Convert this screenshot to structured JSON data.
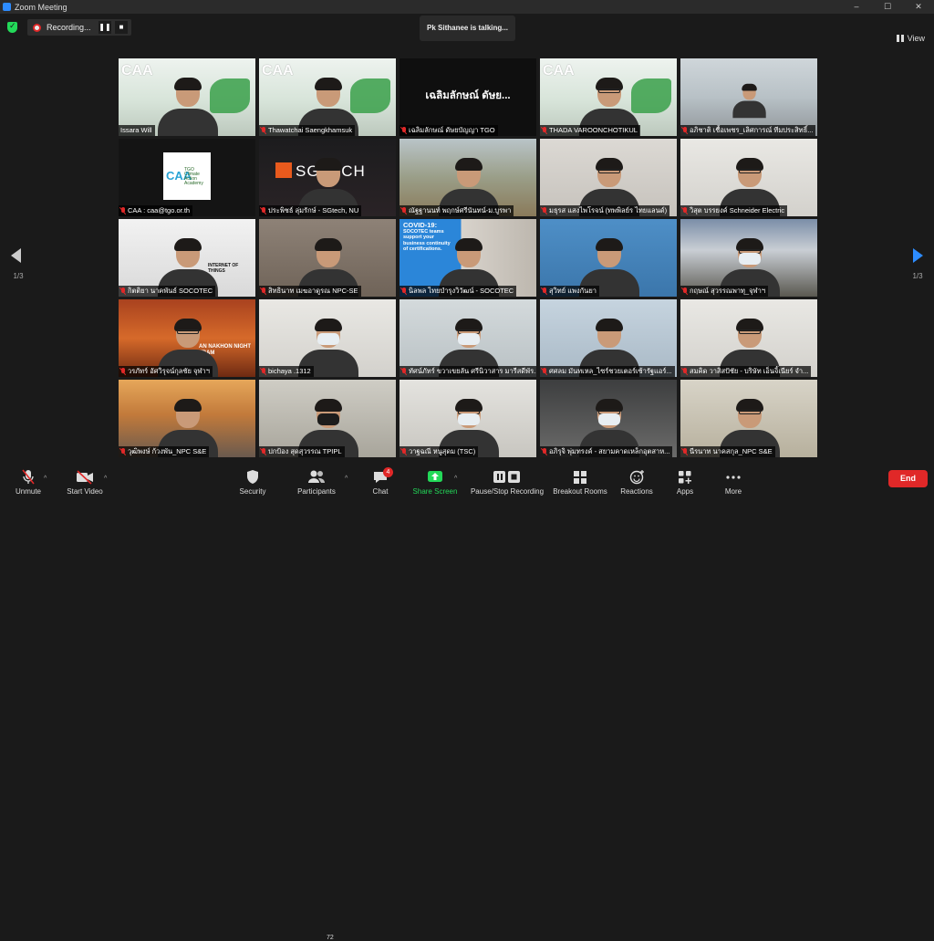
{
  "window": {
    "title": "Zoom Meeting",
    "controls": [
      "–",
      "☐",
      "✕"
    ]
  },
  "recording": {
    "label": "Recording...",
    "pause": "❚❚",
    "stop": "■"
  },
  "talking_banner": "Pk Sithanee is talking...",
  "view_button": "View",
  "pager": {
    "left": "1/3",
    "right": "1/3"
  },
  "participants": [
    {
      "name": "Issara Will",
      "muted": false,
      "bg": "caa"
    },
    {
      "name": "Thawatchai Saengkhamsuk",
      "muted": true,
      "bg": "caa"
    },
    {
      "name": "เฉลิมลักษณ์ ดัษยบัญญา TGO",
      "muted": true,
      "bg": "dark",
      "big_label": "เฉลิมลักษณ์ ดัษย..."
    },
    {
      "name": "THADA VAROONCHOTIKUL",
      "muted": true,
      "bg": "caa"
    },
    {
      "name": "อภิชาติ เชื้อเพชร_เลิศการณ์ ทีมประสิทธิ์...",
      "muted": true,
      "bg": "office"
    },
    {
      "name": "CAA : caa@tgo.or.th",
      "muted": true,
      "bg": "caa-card",
      "card_logo": "CAA",
      "card_text": "TGO Climate Action Academy"
    },
    {
      "name": "ประพิชธ์ ลุ่มรักษ์ - SGtech, NU",
      "muted": true,
      "bg": "sgtech",
      "logo_text": "SGTECH"
    },
    {
      "name": "ณัฐฐานนท์ พฤกษ์ศรีนันทน์-ม.บูรพา",
      "muted": true,
      "bg": "campus"
    },
    {
      "name": "มธุรส แสงไพโรจน์ (ทพพิลย์ร ไทยแลนด์)",
      "muted": true,
      "bg": "lightroom"
    },
    {
      "name": "วิสุต บรรยงค์ Schneider Electric",
      "muted": true,
      "bg": "whiteroom"
    },
    {
      "name": "กิตติยา นาคพันธ์ SOCOTEC",
      "muted": true,
      "bg": "iot",
      "overlay_text": "INTERNET OF THINGS"
    },
    {
      "name": "สิทธินาท เมฆอาดูรณ NPC-SE",
      "muted": true,
      "bg": "office2"
    },
    {
      "name": "นิลพล ไทยบำรุงวิวัฒน์ - SOCOTEC",
      "muted": true,
      "bg": "covid",
      "overlay_title": "COVID-19:",
      "overlay_text": "SOCOTEC teams support your business continuity of certifications."
    },
    {
      "name": "สุวิทย์ แพงกันยา",
      "muted": true,
      "bg": "bluewall"
    },
    {
      "name": "กฤษณ์ สุวรรณพาทุ_จุฬาฯ",
      "muted": true,
      "bg": "mountain"
    },
    {
      "name": "วรภัทร์ อัศวิรุจน์กุลชัย จุฬาฯ",
      "muted": true,
      "bg": "tram",
      "overlay_text": "AN NAKHON NIGHT TRAM"
    },
    {
      "name": "bichaya .1312",
      "muted": true,
      "bg": "whiteroom"
    },
    {
      "name": "ทัศน์ภัทร์ ขวาเขยลัน ศรีนิวาสาร มารีสดีพัร...",
      "muted": true,
      "bg": "office3"
    },
    {
      "name": "ศศลม มันทเหล_ไซร์ชวยเตอร์เซ้ารัฐแอร์...",
      "muted": true,
      "bg": "bluewall2"
    },
    {
      "name": "สมคิด วาสิสปัชัย - บริษัท เอ็นจิ้เนียร์ จำ...",
      "muted": true,
      "bg": "whiteroom"
    },
    {
      "name": "วุฒิพงษ์ ก้วงพัน_NPC S&E",
      "muted": true,
      "bg": "bridge"
    },
    {
      "name": "ปกป้อง สุดสุวรรณ TPIPL",
      "muted": true,
      "bg": "office4"
    },
    {
      "name": "วาฐฉณี หนูสุดม (TSC)",
      "muted": true,
      "bg": "whiteroom2"
    },
    {
      "name": "อภิรุจิ พุ่มทรงค์ - สยามคาดเหล็กอุตสาห...",
      "muted": true,
      "bg": "office5"
    },
    {
      "name": "นีรนาท นาคสกุล_NPC S&E",
      "muted": true,
      "bg": "office6"
    }
  ],
  "toolbar": {
    "unmute": "Unmute",
    "start_video": "Start Video",
    "security": "Security",
    "participants": "Participants",
    "participants_count": "72",
    "chat": "Chat",
    "chat_badge": "4",
    "share_screen": "Share Screen",
    "pause_stop_recording": "Pause/Stop Recording",
    "breakout_rooms": "Breakout Rooms",
    "reactions": "Reactions",
    "apps": "Apps",
    "more": "More",
    "end": "End"
  },
  "colors": {
    "accent": "#2d8cff",
    "danger": "#e02828",
    "share": "#23d959"
  }
}
